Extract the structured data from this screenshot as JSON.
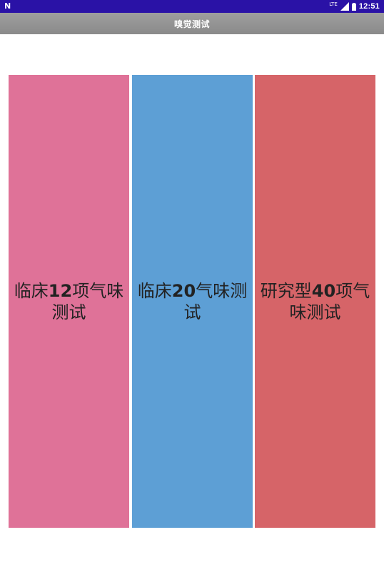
{
  "status_bar": {
    "carrier_icon": "N",
    "network_label": "LTE",
    "time": "12:51",
    "color": "#2a12a6"
  },
  "app_bar": {
    "title": "嗅觉测试",
    "color": "#959595"
  },
  "tests": [
    {
      "label": "临床12项气味测试",
      "color": "#df7298"
    },
    {
      "label": "临床20气味测试",
      "color": "#5d9fd5"
    },
    {
      "label": "研究型40项气味测试",
      "color": "#d66468"
    }
  ]
}
